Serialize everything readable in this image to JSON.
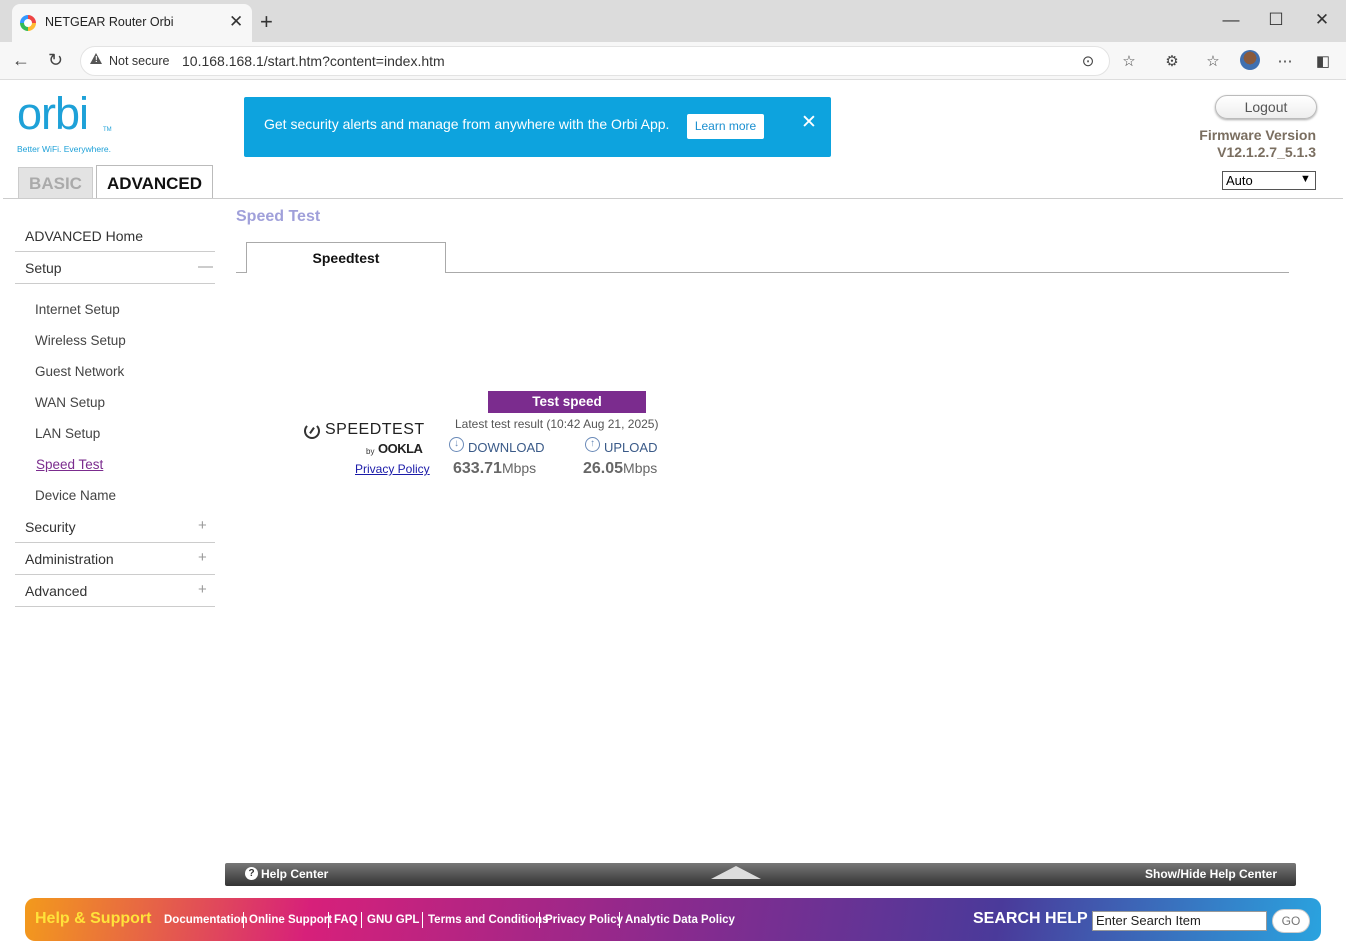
{
  "browser": {
    "tab_title": "NETGEAR Router Orbi",
    "security_label": "Not secure",
    "url": "10.168.168.1/start.htm?content=index.htm"
  },
  "header": {
    "logo": "orbi",
    "tagline": "Better WiFi. Everywhere.",
    "banner_text": "Get security alerts and manage from anywhere with the Orbi App.",
    "banner_button": "Learn more",
    "logout": "Logout",
    "firmware_label": "Firmware Version",
    "firmware_value": "V12.1.2.7_5.1.3",
    "language": "Auto",
    "tabs": [
      "BASIC",
      "ADVANCED"
    ]
  },
  "sidebar": {
    "home": "ADVANCED Home",
    "setup": "Setup",
    "setup_items": [
      "Internet Setup",
      "Wireless Setup",
      "Guest Network",
      "WAN Setup",
      "LAN Setup",
      "Speed Test",
      "Device Name"
    ],
    "security": "Security",
    "administration": "Administration",
    "advanced": "Advanced"
  },
  "main": {
    "page_title": "Speed Test",
    "tab_label": "Speedtest",
    "test_button": "Test speed",
    "brand": "SPEEDTEST",
    "by": "by",
    "ookla": "OOKLA",
    "privacy": "Privacy Policy",
    "latest": "Latest test result (10:42 Aug 21, 2025)",
    "download_label": "DOWNLOAD",
    "upload_label": "UPLOAD",
    "download_value": "633.71",
    "upload_value": "26.05",
    "unit": "Mbps"
  },
  "helpbar": {
    "help_center": "Help Center",
    "toggle": "Show/Hide Help Center"
  },
  "footer": {
    "title": "Help & Support",
    "links": [
      "Documentation",
      "Online Support",
      "FAQ",
      "GNU GPL",
      "Terms and Conditions",
      "Privacy Policy",
      "Analytic Data Policy"
    ],
    "search_label": "SEARCH HELP",
    "search_placeholder": "Enter Search Item",
    "go": "GO"
  }
}
